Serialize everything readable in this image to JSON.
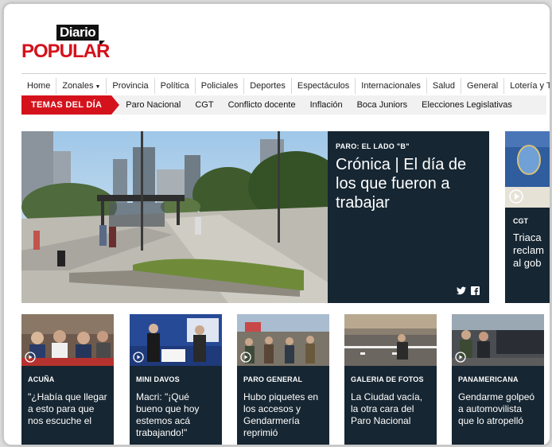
{
  "logo": {
    "top": "Diario",
    "main": "POPULAR"
  },
  "nav": [
    {
      "label": "Home"
    },
    {
      "label": "Zonales",
      "dropdown": true
    },
    {
      "label": "Provincia"
    },
    {
      "label": "Política"
    },
    {
      "label": "Policiales"
    },
    {
      "label": "Deportes"
    },
    {
      "label": "Espectáculos"
    },
    {
      "label": "Internacionales"
    },
    {
      "label": "Salud"
    },
    {
      "label": "General"
    },
    {
      "label": "Lotería y Turf"
    }
  ],
  "temas": {
    "label": "TEMAS DEL DÍA",
    "items": [
      "Paro Nacional",
      "CGT",
      "Conflicto docente",
      "Inflación",
      "Boca Juniors",
      "Elecciones Legislativas"
    ]
  },
  "hero": {
    "kicker": "PARO: EL LADO \"B\"",
    "title": "Crónica | El día de los que fueron a trabajar",
    "icons": [
      "twitter-icon",
      "facebook-icon"
    ]
  },
  "peek": {
    "kicker": "CGT",
    "title_lines": [
      "Triaca",
      "reclam",
      "al gob"
    ]
  },
  "cards": [
    {
      "kicker": "ACUÑA",
      "title": "\"¿Había que llegar a esto para que nos escuche el"
    },
    {
      "kicker": "MINI DAVOS",
      "title": "Macri: \"¡Qué bueno que hoy estemos acá trabajando!\""
    },
    {
      "kicker": "PARO GENERAL",
      "title": "Hubo piquetes en los accesos y Gendarmería reprimió"
    },
    {
      "kicker": "GALERIA DE FOTOS",
      "title": "La Ciudad vacía, la otra cara del Paro Nacional"
    },
    {
      "kicker": "PANAMERICANA",
      "title": "Gendarme golpeó a automovilista que lo atropelló"
    }
  ],
  "colors": {
    "brand_red": "#d4121c",
    "card_bg": "#162632",
    "nav_border": "#d0d0d0"
  }
}
